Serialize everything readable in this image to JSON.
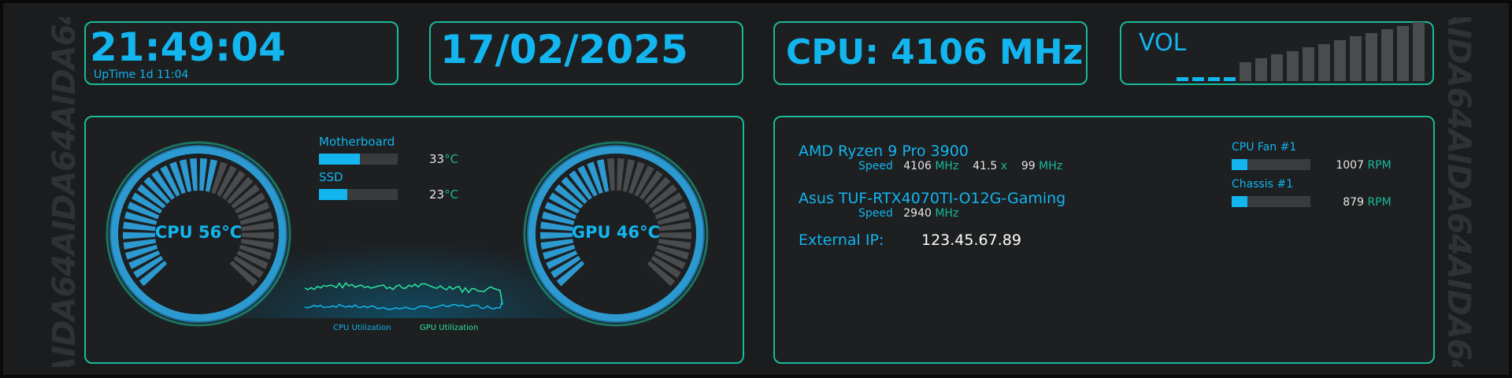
{
  "watermark": "AIDA64AIDA64AIDA64",
  "time": {
    "value": "21:49:04",
    "uptime": "UpTime 1d 11:04"
  },
  "date": {
    "value": "17/02/2025"
  },
  "cpu_clock": {
    "value": "CPU: 4106 MHz"
  },
  "volume": {
    "label": "VOL",
    "level": 0.25
  },
  "sensors": {
    "motherboard": {
      "label": "Motherboard",
      "value": "33",
      "unit": "°C",
      "fill": 0.52
    },
    "ssd": {
      "label": "SSD",
      "value": "23",
      "unit": "°C",
      "fill": 0.36
    }
  },
  "gauges": {
    "cpu": {
      "label": "CPU 56°C",
      "level": 0.56
    },
    "gpu": {
      "label": "GPU 46°C",
      "level": 0.46
    }
  },
  "utilization": {
    "cpu_label": "CPU Utilization",
    "gpu_label": "GPU Utilization"
  },
  "system": {
    "cpu_name": "AMD Ryzen 9 Pro 3900",
    "cpu_speed_label": "Speed",
    "cpu_speed_value": "4106",
    "cpu_speed_unit": "MHz",
    "cpu_multiplier_value": "41.5",
    "cpu_multiplier_unit": "x",
    "cpu_bus_value": "99",
    "cpu_bus_unit": "MHz",
    "gpu_name": "Asus TUF-RTX4070TI-O12G-Gaming",
    "gpu_speed_label": "Speed",
    "gpu_speed_value": "2940",
    "gpu_speed_unit": "MHz",
    "ip_label": "External IP:",
    "ip_value": "123.45.67.89"
  },
  "fans": {
    "cpu_fan": {
      "label": "CPU Fan #1",
      "value": "1007",
      "unit": "RPM",
      "fill": 0.2
    },
    "chassis": {
      "label": "Chassis #1",
      "value": "879",
      "unit": "RPM",
      "fill": 0.2
    }
  },
  "colors": {
    "accent": "#12b5ee",
    "border": "#19b99a",
    "gpu_line": "#2ee6a0",
    "bar_off": "#3a3b3d",
    "segment_off": "#4a4b4d"
  }
}
